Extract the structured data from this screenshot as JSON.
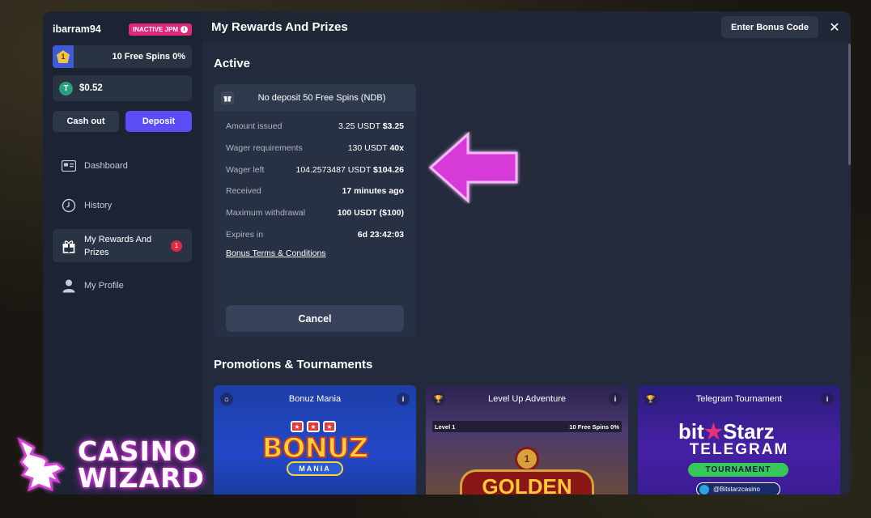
{
  "sidebar": {
    "username": "ibarram94",
    "jpm_badge": "INACTIVE JPM",
    "level_number": "1",
    "level_text": "10 Free Spins 0%",
    "balance_coin": "T",
    "balance": "$0.52",
    "cash_out": "Cash out",
    "deposit": "Deposit",
    "nav": [
      {
        "label": "Dashboard"
      },
      {
        "label": "History"
      },
      {
        "label": "My Rewards And Prizes",
        "count": "1"
      },
      {
        "label": "My Profile"
      }
    ]
  },
  "header": {
    "title": "My Rewards And Prizes",
    "bonus_code_button": "Enter Bonus Code",
    "close": "✕"
  },
  "active": {
    "section_title": "Active",
    "bonus": {
      "name": "No deposit 50 Free Spins (NDB)",
      "rows": [
        {
          "key": "Amount issued",
          "value": "3.25 USDT",
          "value_bold": "$3.25"
        },
        {
          "key": "Wager requirements",
          "value": "130 USDT",
          "value_bold": "40x"
        },
        {
          "key": "Wager left",
          "value": "104.2573487 USDT",
          "value_bold": "$104.26"
        },
        {
          "key": "Received",
          "value": "",
          "value_bold": "17 minutes ago"
        },
        {
          "key": "Maximum withdrawal",
          "value": "",
          "value_bold": "100 USDT ($100)"
        },
        {
          "key": "Expires in",
          "value": "",
          "value_bold": "6d 23:42:03"
        }
      ],
      "terms": "Bonus Terms & Conditions",
      "cancel": "Cancel"
    }
  },
  "promotions": {
    "section_title": "Promotions & Tournaments",
    "cards": [
      {
        "title": "Bonuz Mania",
        "logo_top": "BONUZ",
        "logo_bottom": "MANIA"
      },
      {
        "title": "Level Up Adventure",
        "level": "Level 1",
        "progress": "10 Free Spins 0%",
        "logo": "GOLDEN"
      },
      {
        "title": "Telegram Tournament",
        "brand_a": "bit",
        "brand_star": "★",
        "brand_b": "Starz",
        "line2": "TELEGRAM",
        "pill": "TOURNAMENT",
        "handle": "@Bitstarzcasino"
      }
    ]
  },
  "watermark": {
    "line1": "CASINO",
    "line2": "WIZARD"
  },
  "colors": {
    "accent": "#5b4cf5",
    "badge": "#e0277a",
    "arrow": "#d63ad9"
  }
}
